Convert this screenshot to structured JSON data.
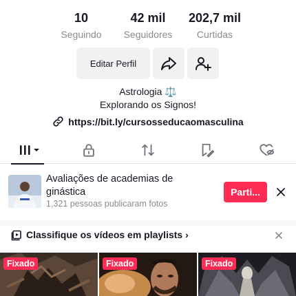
{
  "stats": [
    {
      "value": "10",
      "label": "Seguindo"
    },
    {
      "value": "42 mil",
      "label": "Seguidores"
    },
    {
      "value": "202,7 mil",
      "label": "Curtidas"
    }
  ],
  "actions": {
    "edit_label": "Editar Perfil",
    "share_icon": "share-arrow-icon",
    "add_friend_icon": "add-friend-icon"
  },
  "bio": {
    "line1": "Astrologia ⚖️",
    "line2": "Explorando os Signos!",
    "link": "https://bit.ly/cursosseducaomasculina"
  },
  "tabs": [
    {
      "name": "videos",
      "icon": "grid-bars-icon",
      "active": true
    },
    {
      "name": "private",
      "icon": "lock-icon"
    },
    {
      "name": "reposts",
      "icon": "repost-icon"
    },
    {
      "name": "favorites",
      "icon": "bookmark-icon"
    },
    {
      "name": "liked",
      "icon": "heart-hidden-icon"
    }
  ],
  "promo": {
    "title": "Avaliações de academias de ginástica",
    "subtitle": "1,321 pessoas publicaram fotos",
    "button": "Parti..."
  },
  "playlist": {
    "text": "Classifique os vídeos em playlists"
  },
  "videos": [
    {
      "badge": "Fixado"
    },
    {
      "badge": "Fixado"
    },
    {
      "badge": "Fixado"
    }
  ],
  "colors": {
    "accent": "#fe2c55",
    "text": "#161823",
    "muted": "#8a8b91"
  }
}
